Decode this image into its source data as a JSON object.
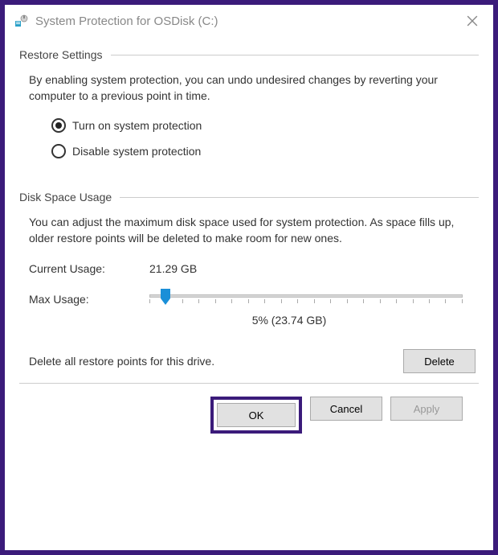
{
  "window": {
    "title": "System Protection for OSDisk (C:)"
  },
  "restore": {
    "section_label": "Restore Settings",
    "description": "By enabling system protection, you can undo undesired changes by reverting your computer to a previous point in time.",
    "option_on": "Turn on system protection",
    "option_off": "Disable system protection"
  },
  "disk": {
    "section_label": "Disk Space Usage",
    "description": "You can adjust the maximum disk space used for system protection. As space fills up, older restore points will be deleted to make room for new ones.",
    "current_label": "Current Usage:",
    "current_value": "21.29 GB",
    "max_label": "Max Usage:",
    "slider_value": "5% (23.74 GB)",
    "delete_text": "Delete all restore points for this drive.",
    "delete_button": "Delete"
  },
  "footer": {
    "ok": "OK",
    "cancel": "Cancel",
    "apply": "Apply"
  }
}
